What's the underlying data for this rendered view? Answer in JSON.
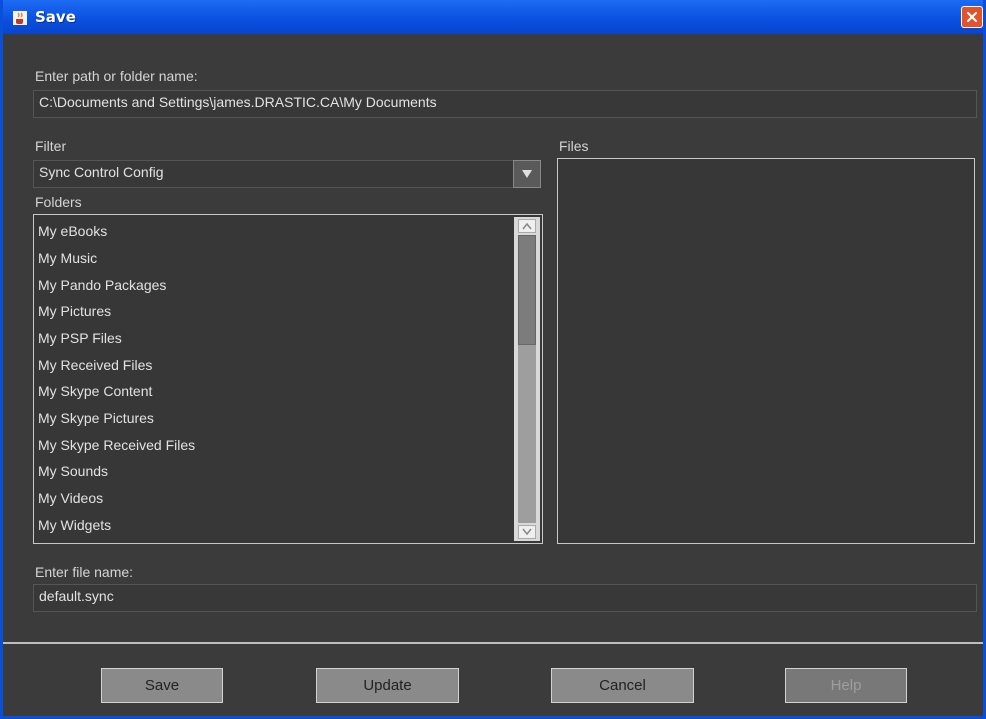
{
  "window": {
    "title": "Save"
  },
  "path": {
    "label": "Enter path or folder name:",
    "value": "C:\\Documents and Settings\\james.DRASTIC.CA\\My Documents"
  },
  "filter": {
    "label": "Filter",
    "selected": "Sync Control Config"
  },
  "folders": {
    "label": "Folders",
    "items": [
      "My eBooks",
      "My Music",
      "My Pando Packages",
      "My Pictures",
      "My PSP Files",
      "My Received Files",
      "My Skype Content",
      "My Skype Pictures",
      "My Skype Received Files",
      "My Sounds",
      "My Videos",
      "My Widgets"
    ]
  },
  "files": {
    "label": "Files"
  },
  "filename": {
    "label": "Enter file name:",
    "value": "default.sync"
  },
  "buttons": {
    "save": "Save",
    "update": "Update",
    "cancel": "Cancel",
    "help": "Help"
  },
  "colors": {
    "titlebar": "#0a4fe0",
    "background": "#3b3b3b",
    "button": "#8a8a8a",
    "close": "#e2522b"
  }
}
